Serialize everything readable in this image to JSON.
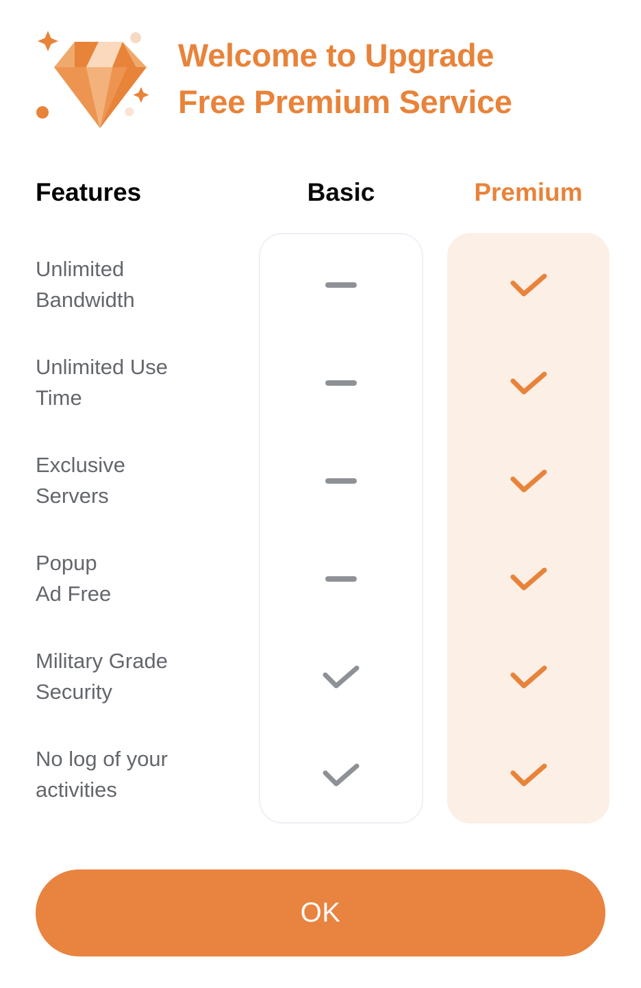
{
  "header": {
    "icon": "diamond-gem-icon",
    "title": "Welcome to Upgrade\nFree Premium Service",
    "title_color": "#E8833A"
  },
  "table": {
    "columns": [
      {
        "key": "features",
        "label": "Features",
        "color": "#000000"
      },
      {
        "key": "basic",
        "label": "Basic",
        "color": "#000000"
      },
      {
        "key": "premium",
        "label": "Premium",
        "color": "#E8833A"
      }
    ],
    "rows": [
      {
        "feature": "Unlimited\nBandwidth",
        "basic": "dash",
        "premium": "check"
      },
      {
        "feature": "Unlimited Use\nTime",
        "basic": "dash",
        "premium": "check"
      },
      {
        "feature": "Exclusive\nServers",
        "basic": "dash",
        "premium": "check"
      },
      {
        "feature": "Popup\nAd Free",
        "basic": "dash",
        "premium": "check"
      },
      {
        "feature": "Military Grade\nSecurity",
        "basic": "check",
        "premium": "check"
      },
      {
        "feature": "No log of your\nactivities",
        "basic": "check",
        "premium": "check"
      }
    ],
    "mark_icons": {
      "dash": "dash-icon",
      "check": "check-icon"
    },
    "basic_card_bg": "#FFFFFF",
    "basic_card_border": "#EEF0F7",
    "premium_card_bg": "#FCEFE6",
    "basic_mark_color": "#8E9196",
    "premium_mark_color": "#E8833A"
  },
  "footer": {
    "ok_label": "OK",
    "ok_bg": "#E88340",
    "ok_text_color": "#FFFFFF"
  }
}
